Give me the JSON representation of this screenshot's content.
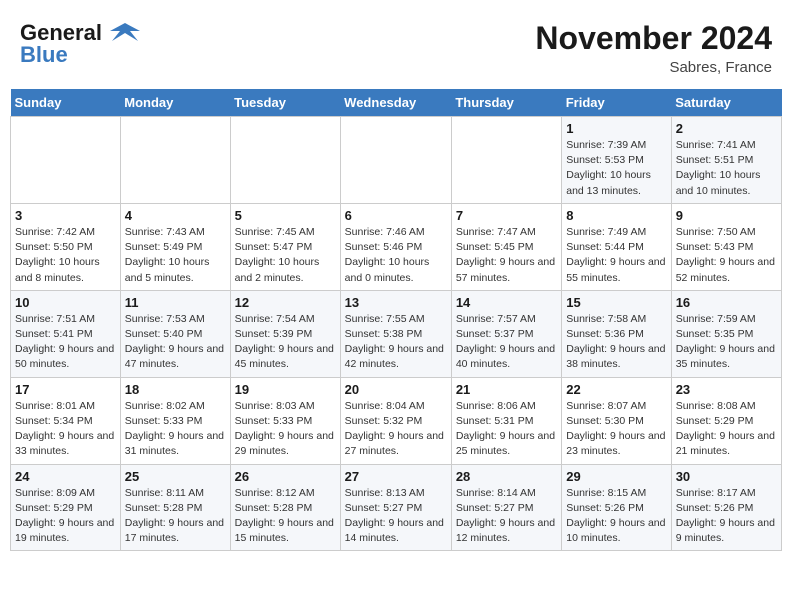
{
  "header": {
    "logo_line1": "General",
    "logo_line2": "Blue",
    "month_title": "November 2024",
    "location": "Sabres, France"
  },
  "days_of_week": [
    "Sunday",
    "Monday",
    "Tuesday",
    "Wednesday",
    "Thursday",
    "Friday",
    "Saturday"
  ],
  "weeks": [
    [
      {
        "day": "",
        "info": ""
      },
      {
        "day": "",
        "info": ""
      },
      {
        "day": "",
        "info": ""
      },
      {
        "day": "",
        "info": ""
      },
      {
        "day": "",
        "info": ""
      },
      {
        "day": "1",
        "info": "Sunrise: 7:39 AM\nSunset: 5:53 PM\nDaylight: 10 hours and 13 minutes."
      },
      {
        "day": "2",
        "info": "Sunrise: 7:41 AM\nSunset: 5:51 PM\nDaylight: 10 hours and 10 minutes."
      }
    ],
    [
      {
        "day": "3",
        "info": "Sunrise: 7:42 AM\nSunset: 5:50 PM\nDaylight: 10 hours and 8 minutes."
      },
      {
        "day": "4",
        "info": "Sunrise: 7:43 AM\nSunset: 5:49 PM\nDaylight: 10 hours and 5 minutes."
      },
      {
        "day": "5",
        "info": "Sunrise: 7:45 AM\nSunset: 5:47 PM\nDaylight: 10 hours and 2 minutes."
      },
      {
        "day": "6",
        "info": "Sunrise: 7:46 AM\nSunset: 5:46 PM\nDaylight: 10 hours and 0 minutes."
      },
      {
        "day": "7",
        "info": "Sunrise: 7:47 AM\nSunset: 5:45 PM\nDaylight: 9 hours and 57 minutes."
      },
      {
        "day": "8",
        "info": "Sunrise: 7:49 AM\nSunset: 5:44 PM\nDaylight: 9 hours and 55 minutes."
      },
      {
        "day": "9",
        "info": "Sunrise: 7:50 AM\nSunset: 5:43 PM\nDaylight: 9 hours and 52 minutes."
      }
    ],
    [
      {
        "day": "10",
        "info": "Sunrise: 7:51 AM\nSunset: 5:41 PM\nDaylight: 9 hours and 50 minutes."
      },
      {
        "day": "11",
        "info": "Sunrise: 7:53 AM\nSunset: 5:40 PM\nDaylight: 9 hours and 47 minutes."
      },
      {
        "day": "12",
        "info": "Sunrise: 7:54 AM\nSunset: 5:39 PM\nDaylight: 9 hours and 45 minutes."
      },
      {
        "day": "13",
        "info": "Sunrise: 7:55 AM\nSunset: 5:38 PM\nDaylight: 9 hours and 42 minutes."
      },
      {
        "day": "14",
        "info": "Sunrise: 7:57 AM\nSunset: 5:37 PM\nDaylight: 9 hours and 40 minutes."
      },
      {
        "day": "15",
        "info": "Sunrise: 7:58 AM\nSunset: 5:36 PM\nDaylight: 9 hours and 38 minutes."
      },
      {
        "day": "16",
        "info": "Sunrise: 7:59 AM\nSunset: 5:35 PM\nDaylight: 9 hours and 35 minutes."
      }
    ],
    [
      {
        "day": "17",
        "info": "Sunrise: 8:01 AM\nSunset: 5:34 PM\nDaylight: 9 hours and 33 minutes."
      },
      {
        "day": "18",
        "info": "Sunrise: 8:02 AM\nSunset: 5:33 PM\nDaylight: 9 hours and 31 minutes."
      },
      {
        "day": "19",
        "info": "Sunrise: 8:03 AM\nSunset: 5:33 PM\nDaylight: 9 hours and 29 minutes."
      },
      {
        "day": "20",
        "info": "Sunrise: 8:04 AM\nSunset: 5:32 PM\nDaylight: 9 hours and 27 minutes."
      },
      {
        "day": "21",
        "info": "Sunrise: 8:06 AM\nSunset: 5:31 PM\nDaylight: 9 hours and 25 minutes."
      },
      {
        "day": "22",
        "info": "Sunrise: 8:07 AM\nSunset: 5:30 PM\nDaylight: 9 hours and 23 minutes."
      },
      {
        "day": "23",
        "info": "Sunrise: 8:08 AM\nSunset: 5:29 PM\nDaylight: 9 hours and 21 minutes."
      }
    ],
    [
      {
        "day": "24",
        "info": "Sunrise: 8:09 AM\nSunset: 5:29 PM\nDaylight: 9 hours and 19 minutes."
      },
      {
        "day": "25",
        "info": "Sunrise: 8:11 AM\nSunset: 5:28 PM\nDaylight: 9 hours and 17 minutes."
      },
      {
        "day": "26",
        "info": "Sunrise: 8:12 AM\nSunset: 5:28 PM\nDaylight: 9 hours and 15 minutes."
      },
      {
        "day": "27",
        "info": "Sunrise: 8:13 AM\nSunset: 5:27 PM\nDaylight: 9 hours and 14 minutes."
      },
      {
        "day": "28",
        "info": "Sunrise: 8:14 AM\nSunset: 5:27 PM\nDaylight: 9 hours and 12 minutes."
      },
      {
        "day": "29",
        "info": "Sunrise: 8:15 AM\nSunset: 5:26 PM\nDaylight: 9 hours and 10 minutes."
      },
      {
        "day": "30",
        "info": "Sunrise: 8:17 AM\nSunset: 5:26 PM\nDaylight: 9 hours and 9 minutes."
      }
    ]
  ]
}
